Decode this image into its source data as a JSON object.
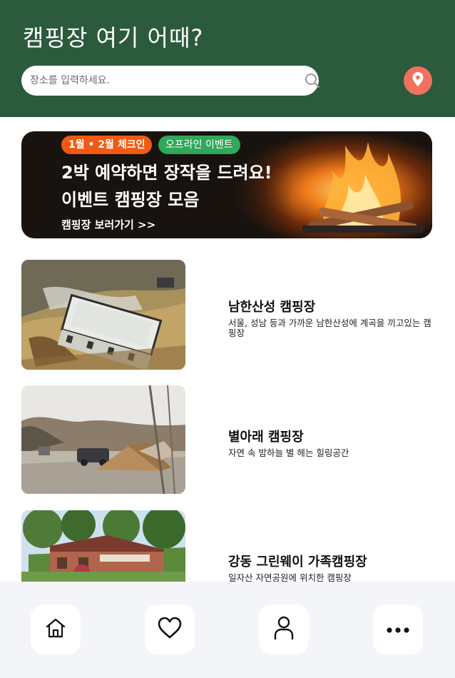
{
  "header": {
    "title": "캠핑장 여기 어때?",
    "search_placeholder": "장소를 입력하세요.",
    "search_icon": "search-icon",
    "location_icon": "location-pin-icon",
    "background_color": "#2c5a3d",
    "location_color": "#f1715e"
  },
  "banner": {
    "tag_checkin": "1월 • 2월 체크인",
    "tag_offline": "오프라인 이벤트",
    "headline_line1": "2박 예약하면 장작을 드려요!",
    "headline_line2": "이벤트 캠핑장 모음",
    "link_text": "캠핑장 보러가기 >>",
    "tag_checkin_color": "#f05a12",
    "tag_offline_color": "#2fa85a"
  },
  "campsites": [
    {
      "name": "남한산성 캠핑장",
      "description": "서울, 성남 등과 가까운 남한산성에 계곡을 끼고있는 캠핑장"
    },
    {
      "name": "별아래 캠핑장",
      "description": "자연 속 밤하늘 별 헤는 힐링공간"
    },
    {
      "name": "강동 그린웨이 가족캠핑장",
      "description": "일자산 자연공원에 위치한 캠핑장"
    }
  ],
  "bottom_nav": {
    "items": [
      {
        "icon": "home-icon"
      },
      {
        "icon": "heart-icon"
      },
      {
        "icon": "user-icon"
      },
      {
        "icon": "more-icon"
      }
    ]
  }
}
